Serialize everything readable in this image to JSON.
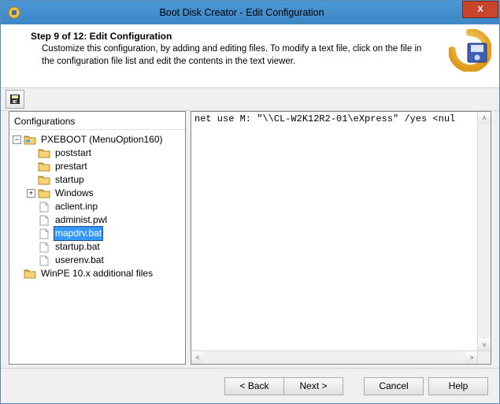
{
  "titlebar": {
    "title": "Boot Disk Creator - Edit Configuration",
    "close": "X"
  },
  "header": {
    "title": "Step 9 of 12: Edit Configuration",
    "desc": "Customize this configuration, by adding and editing files.  To modify a text file, click on the file in the configuration file list and edit the contents in the text viewer."
  },
  "tree": {
    "title": "Configurations",
    "root": {
      "label": "PXEBOOT (MenuOption160)",
      "children": {
        "folders": [
          "poststart",
          "prestart",
          "startup",
          "Windows"
        ],
        "files": [
          "aclient.inp",
          "administ.pwl",
          "mapdrv.bat",
          "startup.bat",
          "userenv.bat"
        ]
      }
    },
    "root2": {
      "label": "WinPE 10.x additional files"
    },
    "selected": "mapdrv.bat"
  },
  "editor": {
    "content": "net use M: \"\\\\CL-W2K12R2-01\\eXpress\" /yes <nul"
  },
  "buttons": {
    "back": "< Back",
    "next": "Next >",
    "cancel": "Cancel",
    "help": "Help"
  }
}
